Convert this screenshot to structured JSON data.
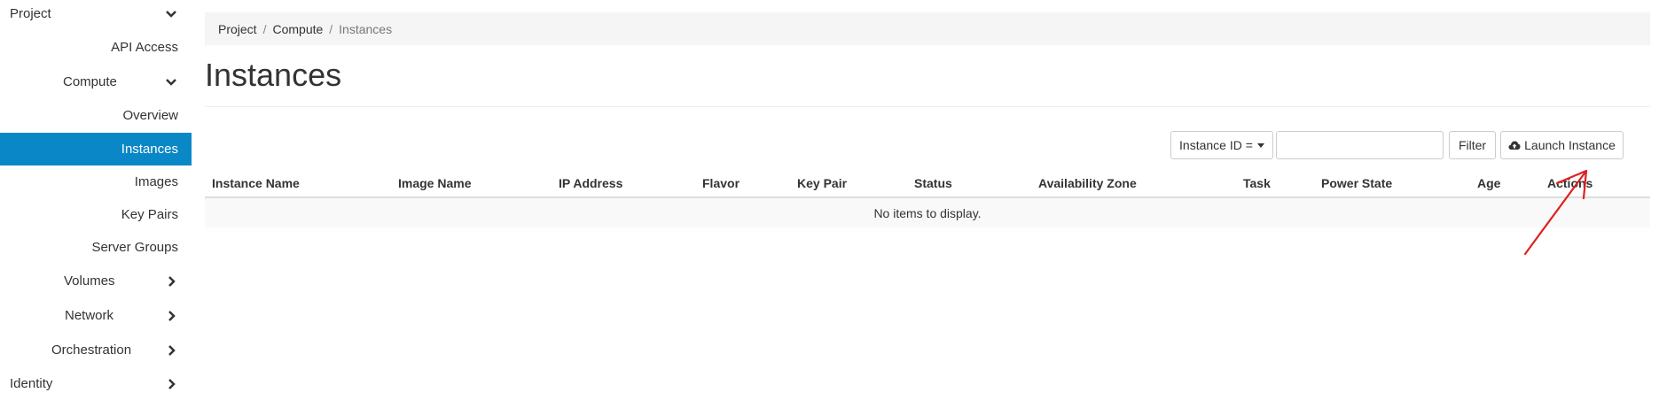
{
  "sidebar": {
    "project": "Project",
    "api_access": "API Access",
    "compute": "Compute",
    "overview": "Overview",
    "instances": "Instances",
    "images": "Images",
    "key_pairs": "Key Pairs",
    "server_groups": "Server Groups",
    "volumes": "Volumes",
    "network": "Network",
    "orchestration": "Orchestration",
    "identity": "Identity",
    "active_color": "#0a87c6"
  },
  "breadcrumb": {
    "items": [
      "Project",
      "Compute"
    ],
    "current": "Instances"
  },
  "page": {
    "title": "Instances"
  },
  "toolbar": {
    "filter_field": "Instance ID =",
    "search_value": "",
    "filter_label": "Filter",
    "launch_label": "Launch Instance"
  },
  "table": {
    "columns": [
      "Instance Name",
      "Image Name",
      "IP Address",
      "Flavor",
      "Key Pair",
      "Status",
      "Availability Zone",
      "Task",
      "Power State",
      "Age",
      "Actions"
    ],
    "empty_message": "No items to display."
  },
  "annotation": {
    "type": "red-arrow",
    "color": "#e02020"
  }
}
